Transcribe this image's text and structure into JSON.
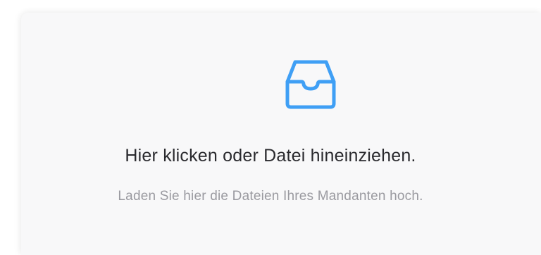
{
  "dropzone": {
    "icon": "inbox-tray-icon",
    "accent_color": "#3f9ff5",
    "title": "Hier klicken oder Datei hineinziehen.",
    "hint": "Laden Sie hier die Dateien Ihres Mandanten hoch."
  }
}
